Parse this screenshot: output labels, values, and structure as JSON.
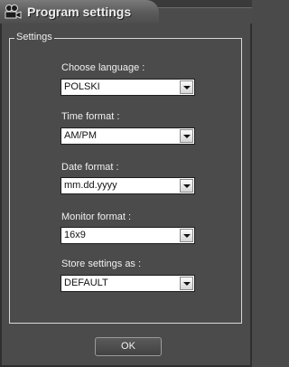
{
  "window": {
    "title": "Program settings",
    "icon": "camera-icon"
  },
  "settings_group": {
    "legend": "Settings"
  },
  "fields": {
    "language": {
      "label": "Choose language :",
      "value": "POLSKI"
    },
    "time_format": {
      "label": "Time format :",
      "value": "AM/PM"
    },
    "date_format": {
      "label": "Date format :",
      "value": "mm.dd.yyyy"
    },
    "monitor_format": {
      "label": "Monitor format :",
      "value": "16x9"
    },
    "store_settings": {
      "label": "Store settings as :",
      "value": "DEFAULT"
    }
  },
  "buttons": {
    "ok_label": "OK"
  }
}
